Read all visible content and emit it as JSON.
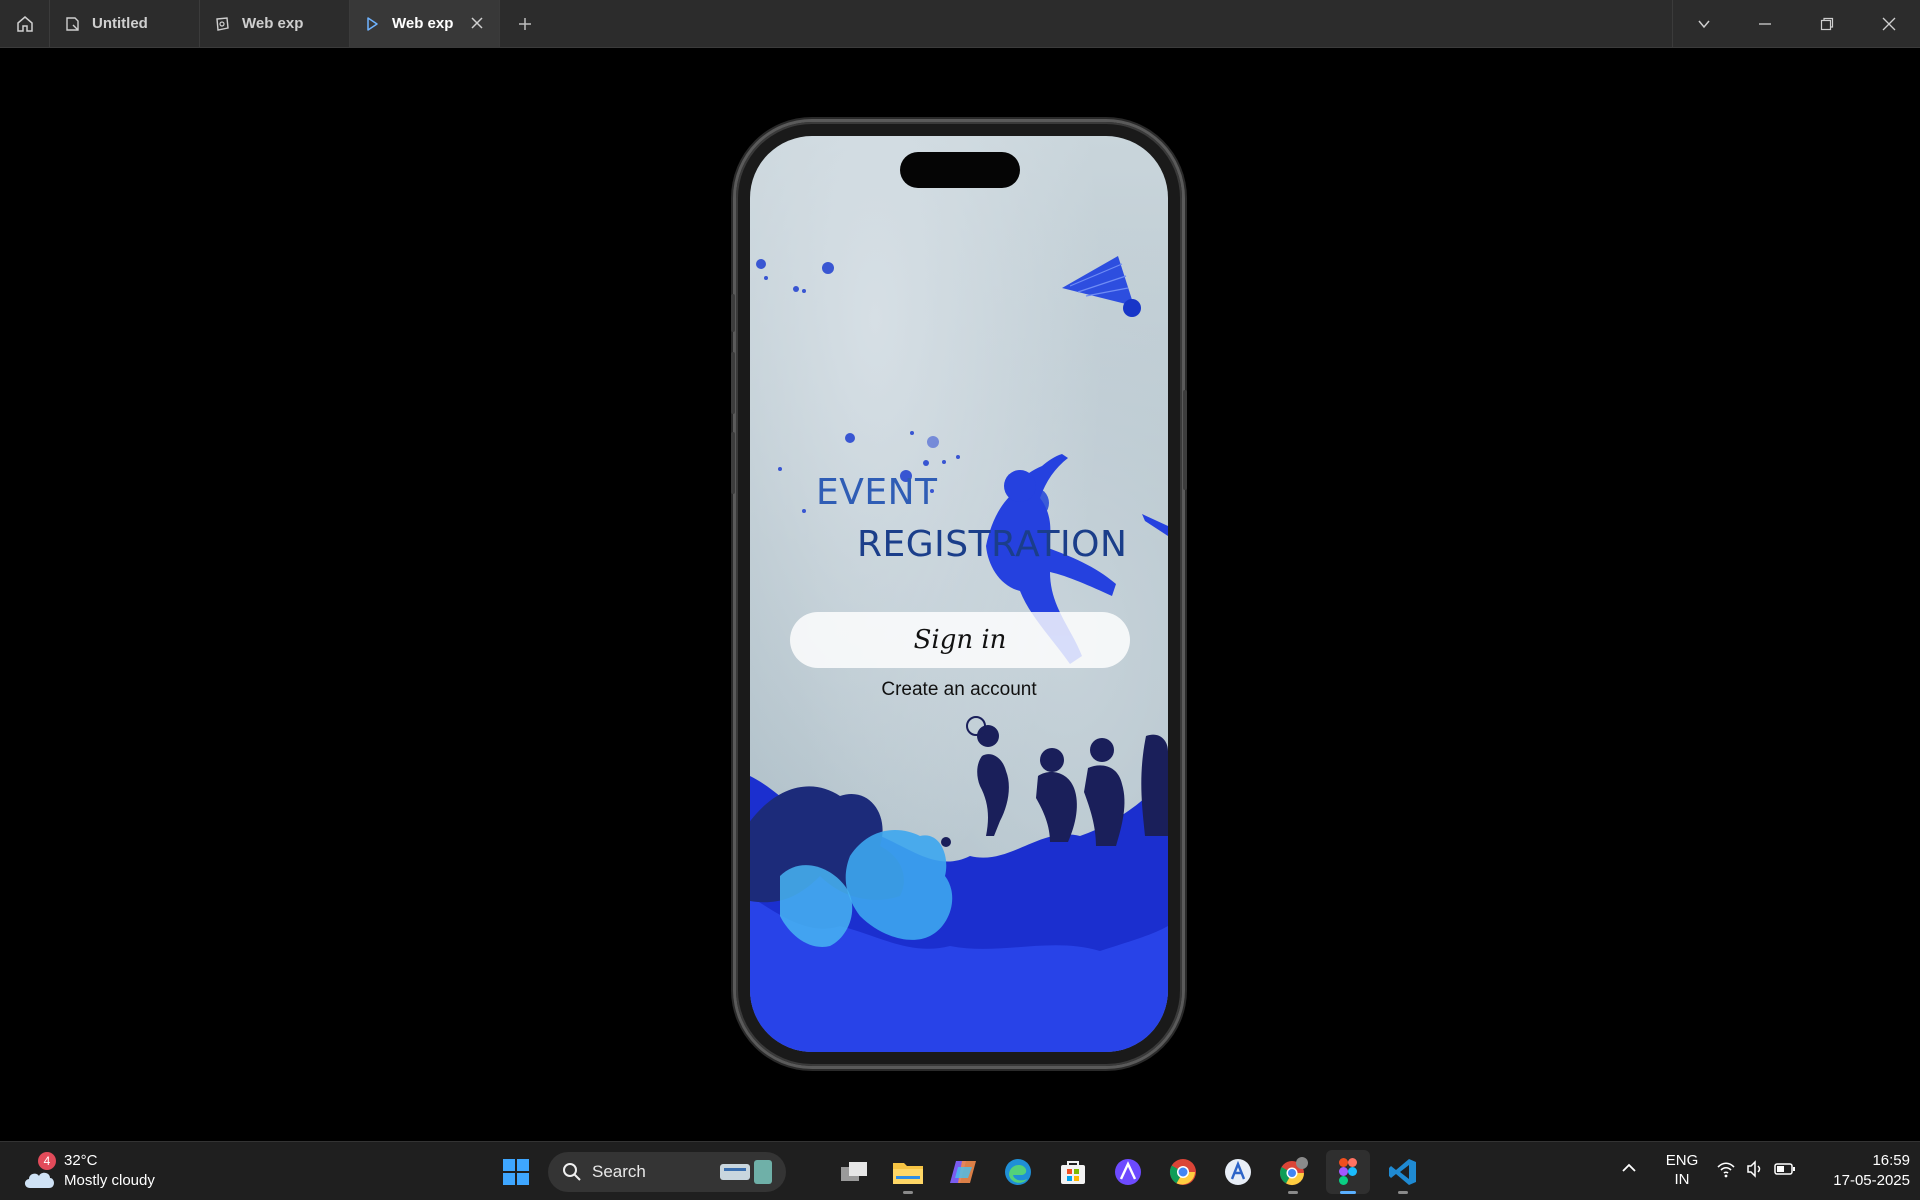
{
  "titlebar": {
    "tabs": [
      {
        "label": "Untitled",
        "icon": "doc-icon"
      },
      {
        "label": "Web exp",
        "icon": "draft-icon"
      },
      {
        "label": "Web exp",
        "icon": "play-icon",
        "active": true
      }
    ]
  },
  "prototype": {
    "title_line1": "EVENT",
    "title_line2": "REGISTRATION",
    "signin_label": "Sign in",
    "create_account_label": "Create an account"
  },
  "taskbar": {
    "weather": {
      "badge": "4",
      "temp": "32°C",
      "desc": "Mostly cloudy"
    },
    "search_label": "Search",
    "lang_line1": "ENG",
    "lang_line2": "IN",
    "time": "16:59",
    "date": "17-05-2025",
    "apps": [
      "windows-start",
      "task-view",
      "file-explorer",
      "copilot",
      "edge",
      "store",
      "proton-vpn",
      "chrome",
      "app-a",
      "chrome-profile",
      "figma",
      "vscode"
    ]
  },
  "colors": {
    "accent_blue": "#2f5db5",
    "dark_blue": "#1b3e8a",
    "silhouette_blue": "#1432e0"
  }
}
